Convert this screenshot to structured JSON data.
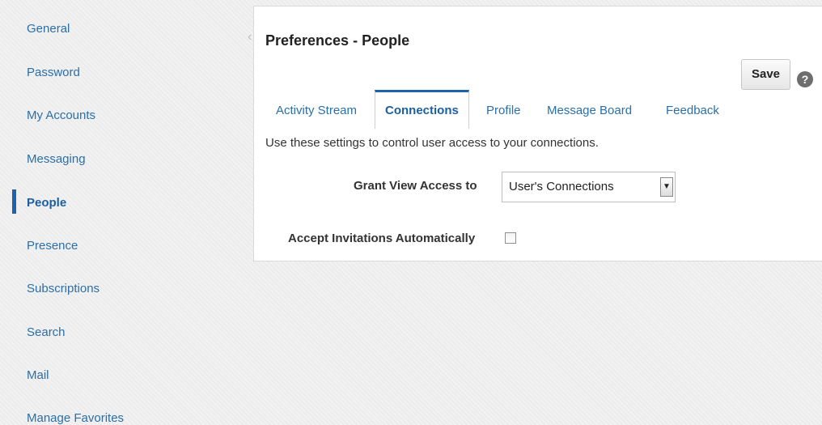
{
  "sidebar": {
    "items": [
      {
        "label": "General"
      },
      {
        "label": "Password"
      },
      {
        "label": "My Accounts"
      },
      {
        "label": "Messaging"
      },
      {
        "label": "People"
      },
      {
        "label": "Presence"
      },
      {
        "label": "Subscriptions"
      },
      {
        "label": "Search"
      },
      {
        "label": "Mail"
      },
      {
        "label": "Manage Favorites"
      }
    ],
    "active": "People"
  },
  "panel": {
    "title": "Preferences - People",
    "save_label": "Save",
    "help_icon": "?",
    "tabs": [
      {
        "label": "Activity Stream"
      },
      {
        "label": "Connections"
      },
      {
        "label": "Profile"
      },
      {
        "label": "Message Board"
      },
      {
        "label": "Feedback"
      }
    ],
    "active_tab": "Connections",
    "description": "Use these settings to control user access to your connections.",
    "grant_label": "Grant View Access to",
    "grant_value": "User's Connections",
    "accept_label": "Accept Invitations Automatically",
    "accept_checked": false
  },
  "colors": {
    "link": "#2a6fa8",
    "accent": "#1d63ab"
  }
}
